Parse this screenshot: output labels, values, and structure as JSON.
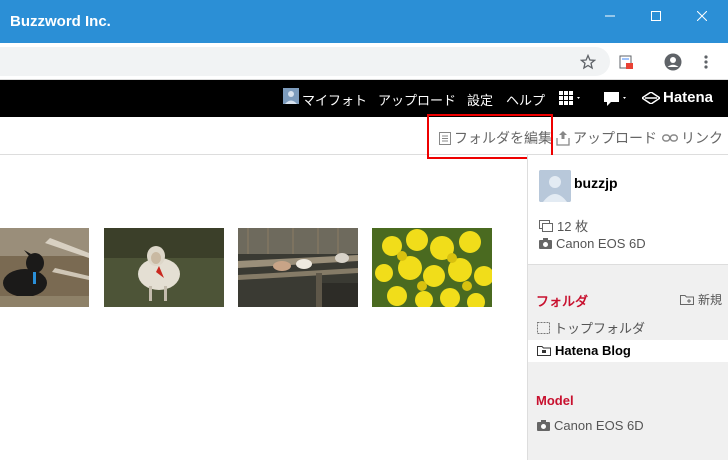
{
  "window": {
    "title": "Buzzword Inc.",
    "minimize_icon": "minimize-icon",
    "maximize_icon": "maximize-icon",
    "close_icon": "close-icon"
  },
  "browser": {
    "url": "",
    "icons": [
      "star-icon",
      "extension-icon",
      "account-icon",
      "menu-dots-icon"
    ]
  },
  "hatena_nav": {
    "my_photo": "マイフォト",
    "upload": "アップロード",
    "settings": "設定",
    "help": "ヘルプ",
    "logo": "Hatena"
  },
  "toolbar": {
    "edit_folder": "フォルダを編集",
    "upload": "アップロード",
    "link": "リンク"
  },
  "photos": [
    {
      "subject": "black goat lying on ground"
    },
    {
      "subject": "white sheep in field"
    },
    {
      "subject": "goats on wooden bridge"
    },
    {
      "subject": "yellow rapeseed flowers"
    }
  ],
  "sidebar": {
    "username": "buzzjp",
    "photo_count": "12 枚",
    "camera": "Canon EOS 6D",
    "folder_heading": "フォルダ",
    "new_label": "新規",
    "top_folder": "トップフォルダ",
    "hatena_blog": "Hatena Blog",
    "model_heading": "Model",
    "model_value": "Canon EOS 6D"
  }
}
